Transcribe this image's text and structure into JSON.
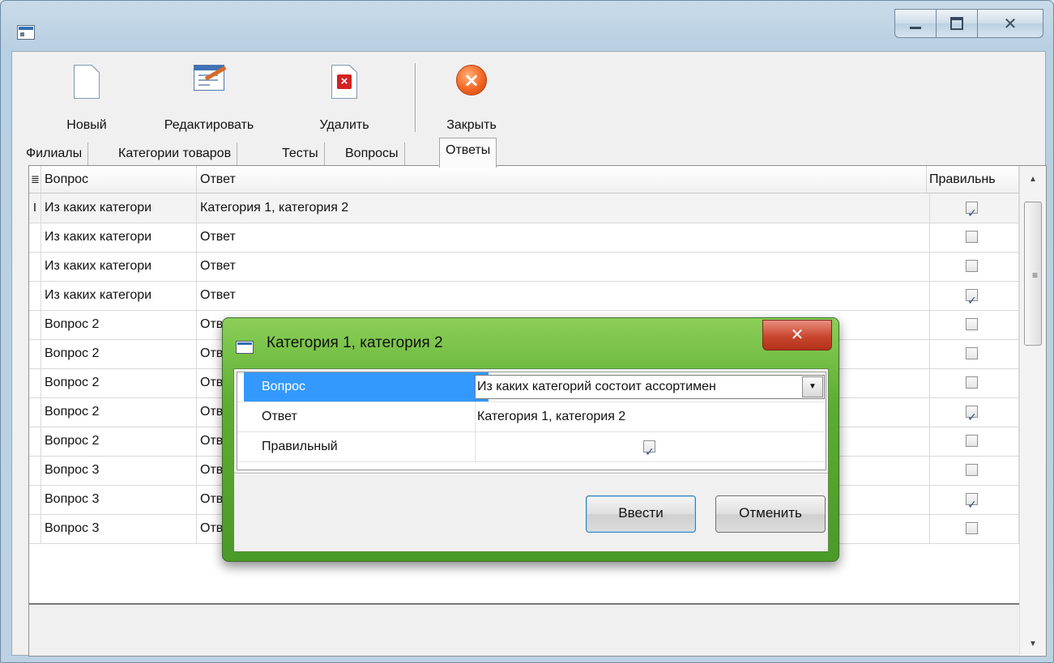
{
  "window": {
    "caption_buttons": [
      "minimize",
      "maximize",
      "close"
    ]
  },
  "toolbar": {
    "new_label": "Новый",
    "edit_label": "Редактировать",
    "delete_label": "Удалить",
    "close_label": "Закрыть"
  },
  "tabs": [
    {
      "label": "Филиалы"
    },
    {
      "label": "Категории товаров"
    },
    {
      "label": "Тесты"
    },
    {
      "label": "Вопросы"
    },
    {
      "label": "Ответы",
      "active": true
    }
  ],
  "grid": {
    "columns": [
      "Вопрос",
      "Ответ",
      "Правильнь"
    ],
    "rows": [
      {
        "question": "Из каких категори",
        "answer": "Категория 1, категория 2",
        "correct": true,
        "current": true
      },
      {
        "question": "Из каких категори",
        "answer": "Ответ",
        "correct": false
      },
      {
        "question": "Из каких категори",
        "answer": "Ответ",
        "correct": false
      },
      {
        "question": "Из каких категори",
        "answer": "Ответ",
        "correct": true
      },
      {
        "question": "Вопрос 2",
        "answer": "Ответ",
        "correct": false
      },
      {
        "question": "Вопрос 2",
        "answer": "Ответ",
        "correct": false
      },
      {
        "question": "Вопрос 2",
        "answer": "Ответ",
        "correct": false
      },
      {
        "question": "Вопрос 2",
        "answer": "Ответ",
        "correct": true
      },
      {
        "question": "Вопрос 2",
        "answer": "Ответ",
        "correct": false
      },
      {
        "question": "Вопрос 3",
        "answer": "Ответ",
        "correct": false
      },
      {
        "question": "Вопрос 3",
        "answer": "Ответ",
        "correct": true
      },
      {
        "question": "Вопрос 3",
        "answer": "Ответ",
        "correct": false
      }
    ]
  },
  "dialog": {
    "title": "Категория 1, категория 2",
    "fields": {
      "question_label": "Вопрос",
      "question_value": "Из каких категорий состоит  ассортимен",
      "answer_label": "Ответ",
      "answer_value": "Категория 1, категория 2",
      "correct_label": "Правильный",
      "correct_value": true
    },
    "ok_label": "Ввести",
    "cancel_label": "Отменить"
  },
  "colors": {
    "selection": "#3399ff",
    "dialog_frame": "#5cae32",
    "window_frame": "#b8d0e3"
  }
}
